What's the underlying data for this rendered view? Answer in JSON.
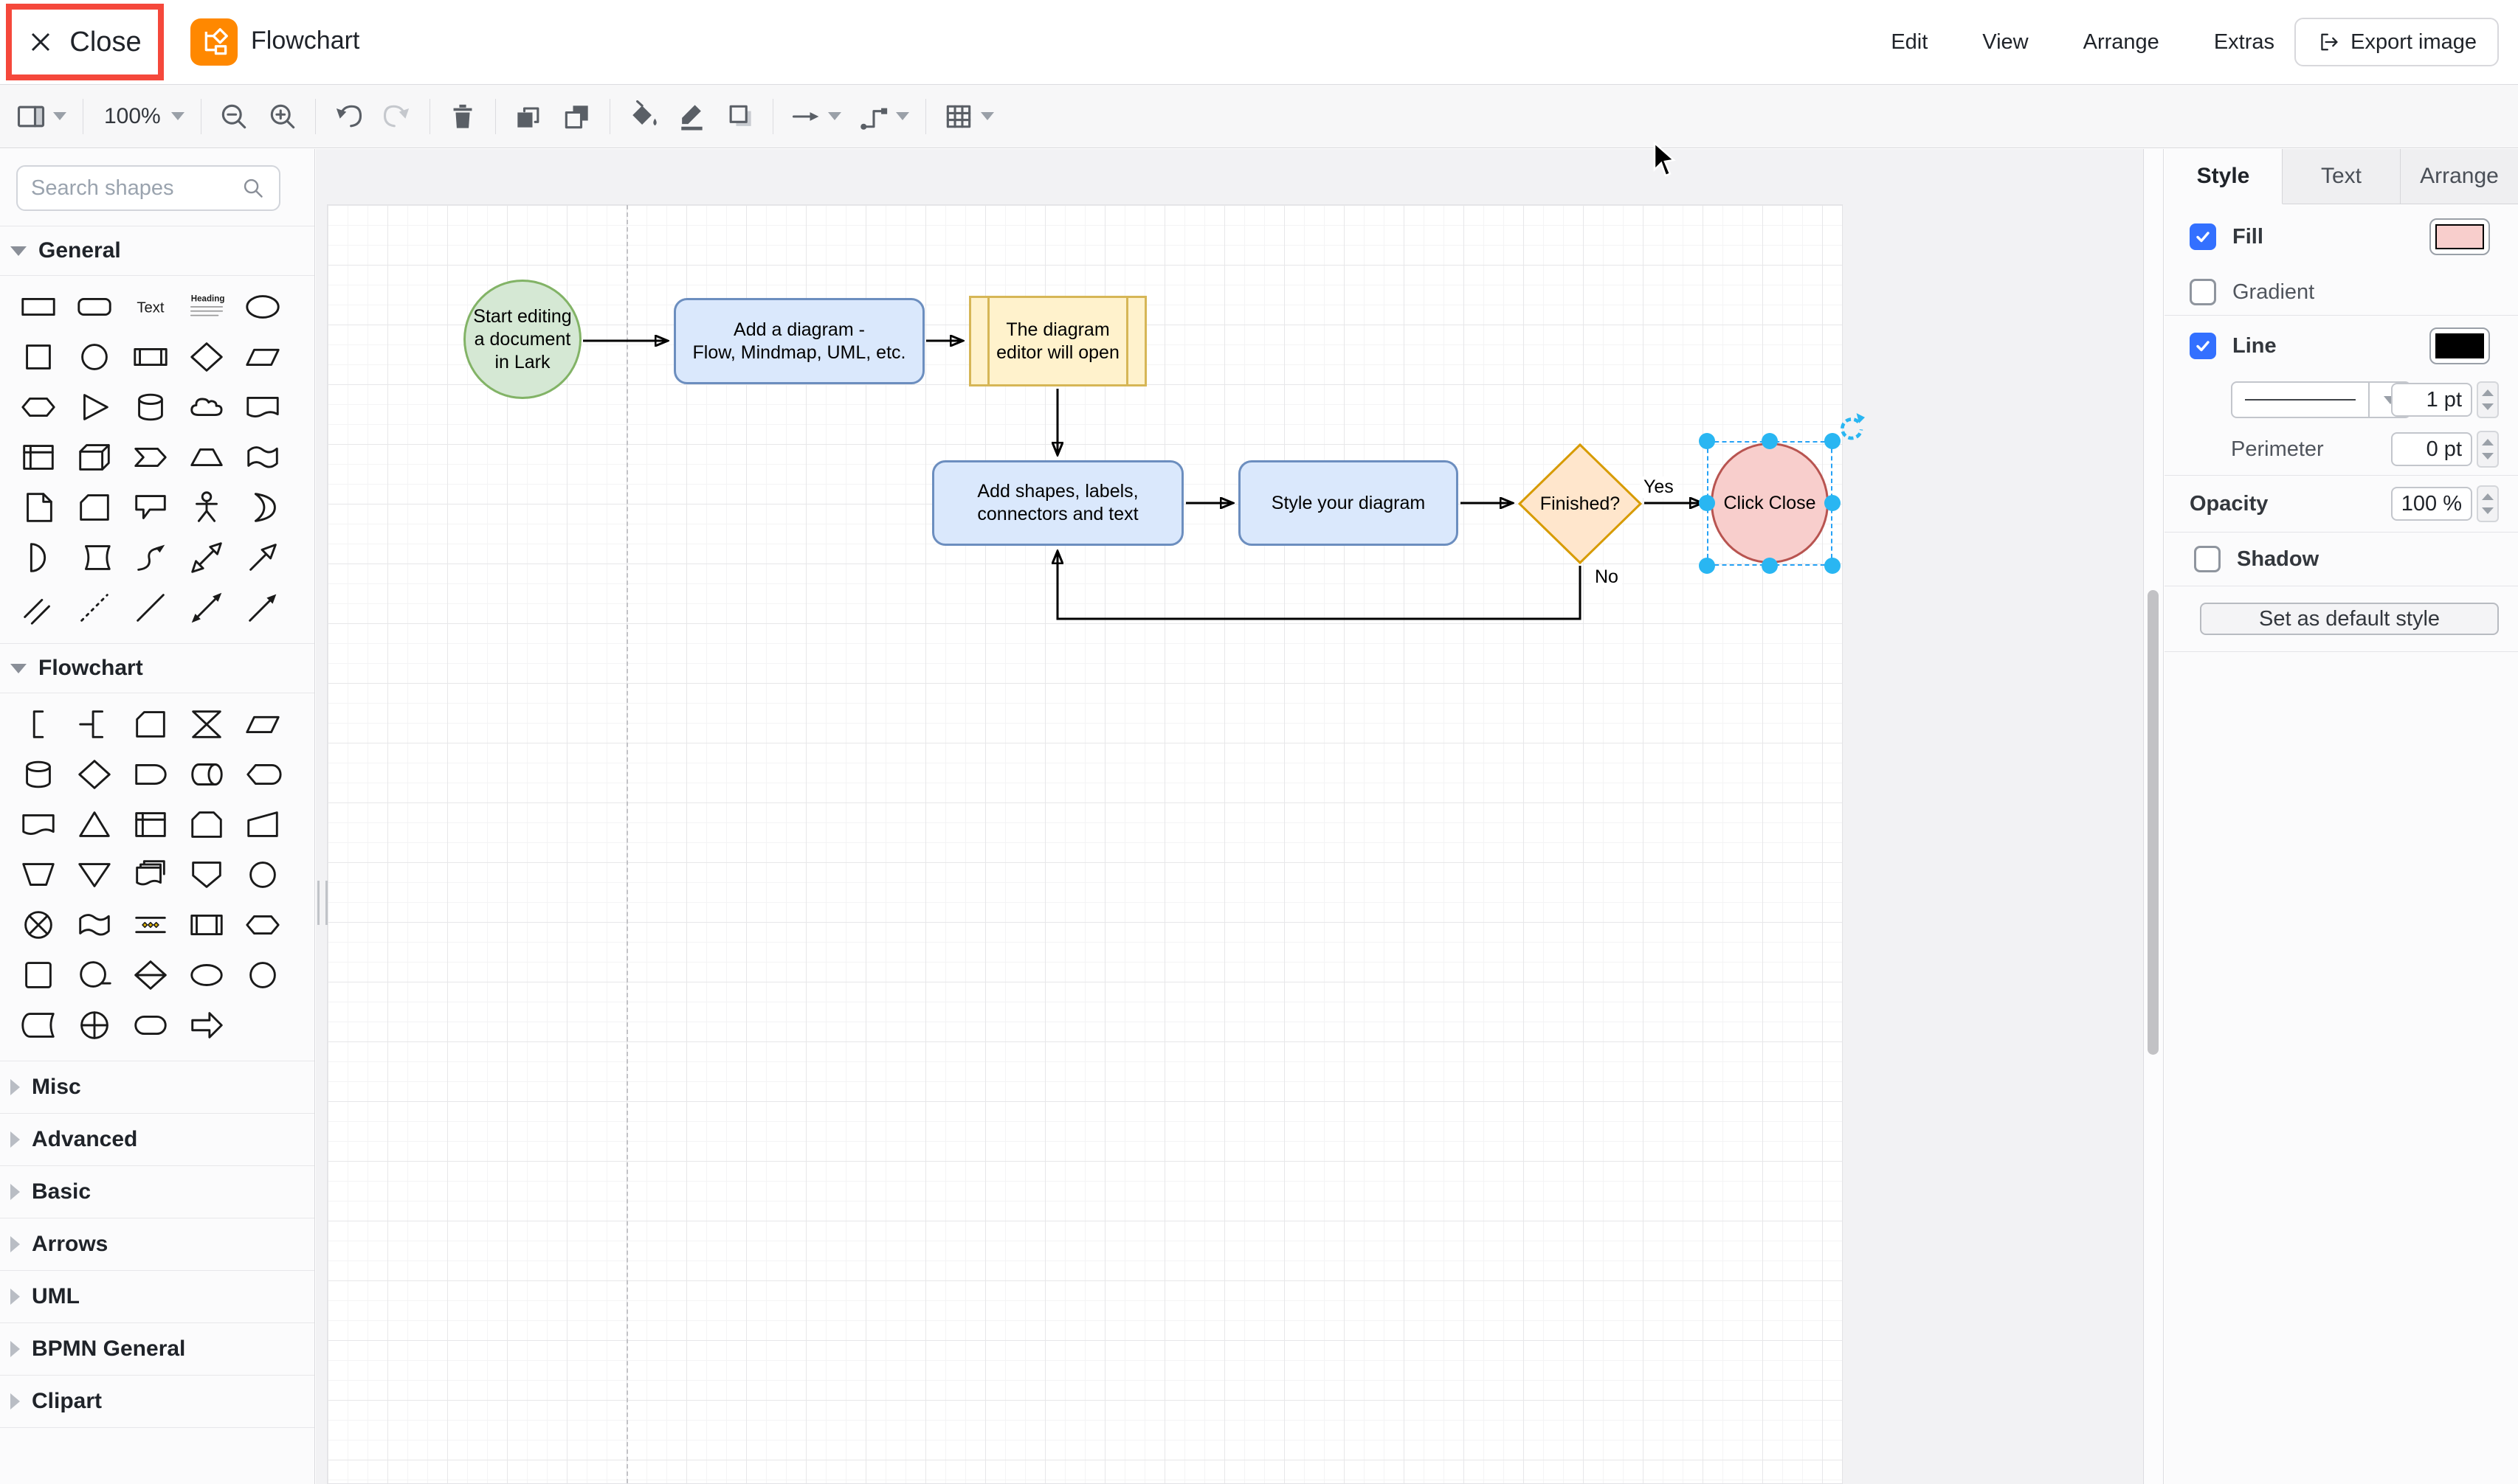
{
  "header": {
    "close_label": "Close",
    "app_title": "Flowchart",
    "menus": [
      "Edit",
      "View",
      "Arrange",
      "Extras"
    ],
    "export_label": "Export image"
  },
  "toolbar": {
    "zoom_level": "100%",
    "groups": [
      [
        {
          "icon": "page-view",
          "caret": true
        }
      ],
      [
        {
          "icon": "zoom-level",
          "caret": true
        }
      ],
      [
        {
          "icon": "zoom-out"
        },
        {
          "icon": "zoom-in"
        }
      ],
      [
        {
          "icon": "undo"
        },
        {
          "icon": "redo",
          "disabled": true
        }
      ],
      [
        {
          "icon": "delete"
        }
      ],
      [
        {
          "icon": "to-front"
        },
        {
          "icon": "to-back"
        }
      ],
      [
        {
          "icon": "fill-color"
        },
        {
          "icon": "line-color"
        },
        {
          "icon": "shadow"
        }
      ],
      [
        {
          "icon": "connection",
          "caret": true
        },
        {
          "icon": "waypoints",
          "caret": true
        }
      ],
      [
        {
          "icon": "table",
          "caret": true
        }
      ]
    ]
  },
  "sidebar": {
    "search_placeholder": "Search shapes",
    "sections": [
      {
        "label": "General",
        "expanded": true,
        "shapes": [
          "rectangle",
          "rounded-rectangle",
          "text",
          "heading",
          "ellipse",
          "square",
          "circle",
          "process",
          "diamond",
          "parallelogram",
          "hexagon",
          "triangle",
          "cylinder",
          "cloud",
          "document",
          "internal-storage",
          "cube",
          "step",
          "trapezoid",
          "tape",
          "note",
          "card",
          "callout",
          "actor",
          "or",
          "and",
          "data-storage",
          "curve",
          "bidirectional-arrow",
          "arrow",
          "link",
          "dotted-line",
          "line",
          "bidirectional-connector",
          "directional-connector"
        ]
      },
      {
        "label": "Flowchart",
        "expanded": true,
        "shapes": [
          "annotation",
          "annotation-2",
          "card",
          "collate",
          "data",
          "database",
          "decision",
          "delay",
          "direct-access-storage",
          "display",
          "document",
          "extract",
          "internal-storage",
          "loop-limit",
          "manual-input",
          "manual-operation",
          "merge",
          "multi-document",
          "off-page-connector",
          "connector",
          "or-junction",
          "paper-tape",
          "parallel-mode",
          "predefined-process",
          "preparation",
          "process-shape",
          "sequential-access",
          "sort",
          "start",
          "connector-2",
          "stored-data",
          "summing-junction",
          "terminator",
          "transfer"
        ]
      },
      {
        "label": "Misc",
        "expanded": false
      },
      {
        "label": "Advanced",
        "expanded": false
      },
      {
        "label": "Basic",
        "expanded": false
      },
      {
        "label": "Arrows",
        "expanded": false
      },
      {
        "label": "UML",
        "expanded": false
      },
      {
        "label": "BPMN General",
        "expanded": false
      },
      {
        "label": "Clipart",
        "expanded": false
      }
    ]
  },
  "canvas": {
    "nodes": [
      {
        "id": "start",
        "label": "Start editing\na document\nin Lark",
        "shape": "ellipse",
        "fill": "#d5e8d4",
        "stroke": "#82b366"
      },
      {
        "id": "add-diagram",
        "label": "Add a diagram -\nFlow, Mindmap, UML, etc.",
        "shape": "rounded-rectangle",
        "fill": "#dae8fc",
        "stroke": "#6c8ebf"
      },
      {
        "id": "editor-open",
        "label": "The diagram\neditor will open",
        "shape": "process",
        "fill": "#fff2cc",
        "stroke": "#d6b656"
      },
      {
        "id": "add-shapes",
        "label": "Add shapes, labels,\nconnectors and text",
        "shape": "rounded-rectangle",
        "fill": "#dae8fc",
        "stroke": "#6c8ebf"
      },
      {
        "id": "style-diagram",
        "label": "Style your diagram",
        "shape": "rounded-rectangle",
        "fill": "#dae8fc",
        "stroke": "#6c8ebf"
      },
      {
        "id": "finished",
        "label": "Finished?",
        "shape": "diamond",
        "fill": "#ffe6cc",
        "stroke": "#d79b00"
      },
      {
        "id": "click-close",
        "label": "Click Close",
        "shape": "ellipse",
        "fill": "#f8cecc",
        "stroke": "#b85450",
        "selected": true
      }
    ],
    "edge_labels": {
      "yes": "Yes",
      "no": "No"
    },
    "selection_color": "#29b6f2"
  },
  "panel": {
    "tabs": [
      "Style",
      "Text",
      "Arrange"
    ],
    "active_tab": "Style",
    "fill": {
      "label": "Fill",
      "checked": true,
      "color": "#F8CECC"
    },
    "gradient": {
      "label": "Gradient",
      "checked": false
    },
    "line": {
      "label": "Line",
      "checked": true,
      "color": "#000000",
      "width": "1 pt"
    },
    "perimeter": {
      "label": "Perimeter",
      "value": "0 pt"
    },
    "opacity": {
      "label": "Opacity",
      "value": "100 %"
    },
    "shadow": {
      "label": "Shadow",
      "checked": false
    },
    "set_default_label": "Set as default style"
  }
}
